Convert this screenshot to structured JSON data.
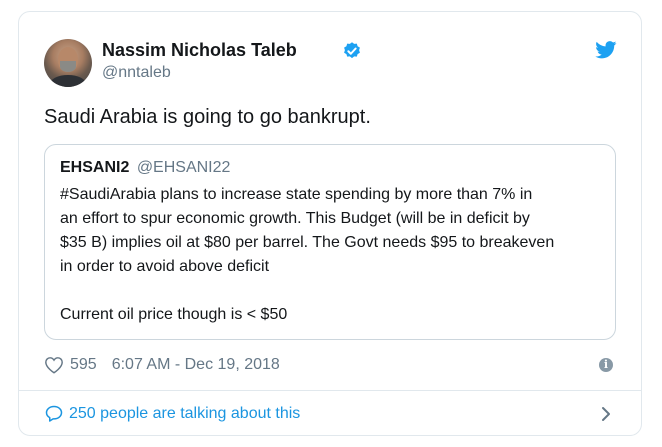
{
  "tweet": {
    "author_name": "Nassim Nicholas Taleb",
    "author_handle": "@nntaleb",
    "text": "Saudi Arabia is going to go bankrupt.",
    "likes": "595",
    "timestamp": "6:07 AM - Dec 19, 2018",
    "talking": "250 people are talking about this"
  },
  "quote": {
    "name": "EHSANI2",
    "handle": "@EHSANI22",
    "lines": [
      "#SaudiArabia  plans to increase state spending by more than 7% in",
      "an effort to spur economic growth. This Budget (will be in deficit by",
      "$35 B) implies oil at $80 per barrel. The Govt needs $95 to breakeven",
      "in order to avoid above deficit",
      "",
      "Current oil price though is < $50"
    ]
  },
  "icons": {
    "verified": "verified-badge-icon",
    "brand": "twitter-bird-icon",
    "like": "heart-icon",
    "info": "info-icon",
    "reply": "speech-bubble-icon",
    "more": "chevron-right-icon"
  },
  "colors": {
    "brand_blue": "#1da1f2",
    "link_blue": "#1b95e0",
    "secondary_text": "#657786",
    "border": "#e1e8ed"
  }
}
